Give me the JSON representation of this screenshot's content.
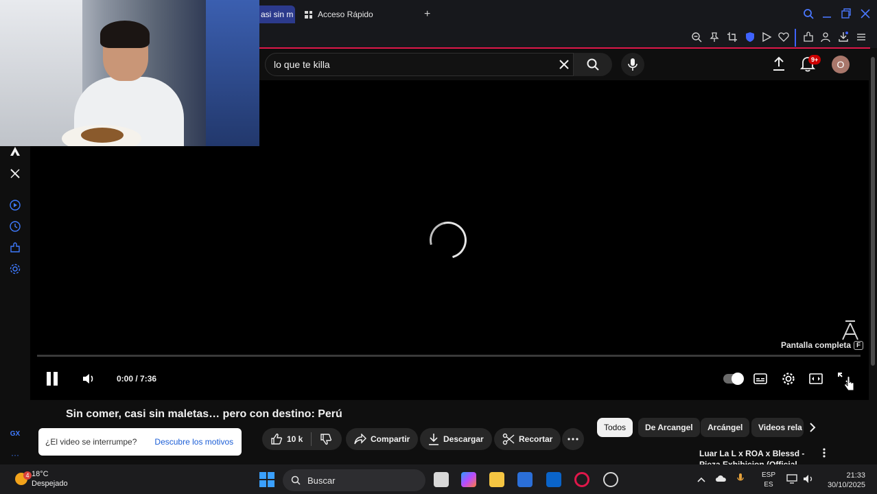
{
  "browser": {
    "tabs": [
      {
        "label": "asi sin m",
        "active": true
      },
      {
        "label": "Acceso Rápido",
        "active": false
      }
    ],
    "new_tab_symbol": "+",
    "accent_color": "#e0174a"
  },
  "youtube": {
    "search_query": "lo que te killa",
    "notification_count": "9+",
    "avatar_initial": "O"
  },
  "player": {
    "time": "0:00 / 7:36",
    "fullscreen_tooltip": "Pantalla completa",
    "fullscreen_key": "F",
    "progress": 0.0
  },
  "video": {
    "title": "Sin comer, casi sin maletas… pero con destino: Perú",
    "interrupt_question": "¿El video se interrumpe?",
    "interrupt_link": "Descubre los motivos",
    "likes": "10 k",
    "share": "Compartir",
    "download": "Descargar",
    "clip": "Recortar"
  },
  "chips": [
    "Todos",
    "De Arcangel",
    "Arcángel",
    "Videos rela"
  ],
  "recommendation": {
    "title": "Luar La L x ROA x Blessd - Pieza Exhibicion (Official Video)"
  },
  "sidebar": {
    "gx_label": "GX",
    "more": "···"
  },
  "taskbar": {
    "temperature": "18°C",
    "weather": "Despejado",
    "weather_badge": "4",
    "search_placeholder": "Buscar",
    "lang_top": "ESP",
    "lang_bottom": "ES",
    "time": "21:33",
    "date": "30/10/2025"
  }
}
